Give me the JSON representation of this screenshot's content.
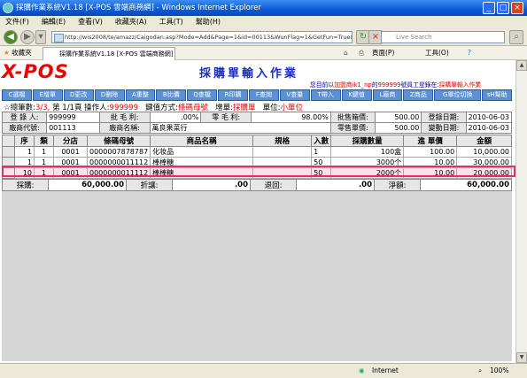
{
  "window": {
    "title": "採購作業系統V1.18 [X-POS 雲端商務網] - Windows Internet Explorer"
  },
  "menu": [
    "文件(F)",
    "編輯(E)",
    "查看(V)",
    "收藏夾(A)",
    "工具(T)",
    "幫助(H)"
  ],
  "browser": {
    "address": "http://wis2008/te/amazz/Caigodan.asp?Mode=Add&Page=1&id=00113&WunFlag=1&GetFun=True&Act=Edit",
    "search_placeholder": "Live Search",
    "favorites_label": "收藏夾",
    "tab_title": "採購作業系統V1.18 [X-POS 雲端商務網]",
    "page_menu": "頁面(P)",
    "tools_menu": "工具(O)"
  },
  "app": {
    "logo": "X-POS",
    "title": "採購單輸入作業",
    "welcome_prefix": "您目前以",
    "welcome_user": "加盟商ik1_np",
    "welcome_mid": "的",
    "welcome_id": "999999",
    "welcome_mid2": "號員工登錄在:",
    "welcome_page": "採購單輸入作業"
  },
  "buttons": [
    "C選檔",
    "E增單",
    "D更改",
    "D刪除",
    "A重整",
    "B比價",
    "Q查檔",
    "R印購",
    "F查詢",
    "V查量",
    "T帶入",
    "K鍵值",
    "L廠商",
    "Z商品",
    "G單位切換",
    "sH幫助"
  ],
  "info": {
    "label1": "☆總筆數:",
    "value1": "3/3,",
    "label2": "第 1/1頁",
    "label3": "操作人:",
    "value3": "999999",
    "label4": "鍵值方式:",
    "value4": "條碼母號",
    "label5": "增單:",
    "value5": "採購單",
    "label6": "單位:",
    "value6": "小單位"
  },
  "header": {
    "row1": [
      {
        "l": "登 錄 人:",
        "v": "999999"
      },
      {
        "l": "批 毛 利:",
        "v": ".00%"
      },
      {
        "l": "零 毛 利:",
        "v": "98.00%"
      },
      {
        "l": "批售箱價:",
        "v": "500.00"
      },
      {
        "l": "登錄日期:",
        "v": "2010-06-03"
      }
    ],
    "row2": [
      {
        "l": "廠商代號:",
        "v": "001113"
      },
      {
        "l": "廠商名稱:",
        "v": "萬良果菜行"
      },
      {
        "l": "零售單價:",
        "v": "500.00"
      },
      {
        "l": "變動日期:",
        "v": "2010-06-03"
      }
    ]
  },
  "grid": {
    "columns": [
      "序",
      "類",
      "分店",
      "條碼母號",
      "商品名稱",
      "規格",
      "入數",
      "採購數量",
      "進 單價",
      "金額"
    ],
    "rows": [
      [
        "1",
        "1",
        "0001",
        "0000007878787",
        "化妆品",
        "",
        "1",
        "100盒",
        "100.00",
        "10,000.00"
      ],
      [
        "1",
        "1",
        "0001",
        "0000000011112",
        "棒棒糖",
        "",
        "50",
        "3000个",
        "10.00",
        "30,000.00"
      ],
      [
        "10",
        "1",
        "0001",
        "0000000011112",
        "棒棒糖",
        "",
        "50",
        "2000个",
        "10.00",
        "20,000.00"
      ]
    ]
  },
  "summary": {
    "l1": "採購:",
    "v1": "60,000.00",
    "l2": "折讓:",
    ".v2": "",
    "v2": ".00",
    "l3": "退回:",
    "v3": ".00",
    "l4": "淨額:",
    "v4": "60,000.00"
  },
  "status": {
    "zone": "Internet",
    "zoom": "100%"
  },
  "colors": {
    "title_bar": "#0a5ad8",
    "logo": "#e00000",
    "app_title": "#1a2fbd",
    "button_bg": "#5b8fd6",
    "selected_row": "#fde0ea",
    "selected_border": "#e0306a"
  }
}
